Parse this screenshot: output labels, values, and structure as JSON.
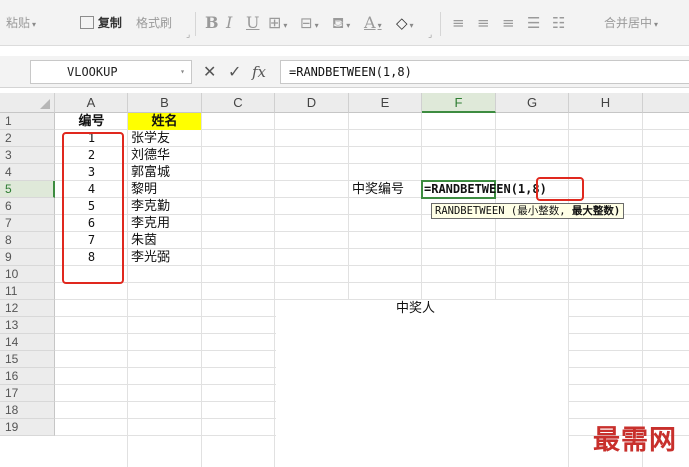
{
  "ribbon": {
    "paste": "粘贴",
    "copy": "复制",
    "format_painter": "格式刷",
    "bold": "B",
    "italic": "I",
    "underline": "U",
    "font_color_letter": "A",
    "merge_center": "合并居中"
  },
  "formula_bar": {
    "name_box": "VLOOKUP",
    "cancel_symbol": "✕",
    "enter_symbol": "✓",
    "fx_label": "fx",
    "formula": "=RANDBETWEEN(1,8)"
  },
  "columns": [
    "A",
    "B",
    "C",
    "D",
    "E",
    "F",
    "G",
    "H"
  ],
  "rows": [
    "1",
    "2",
    "3",
    "4",
    "5",
    "6",
    "7",
    "8",
    "9",
    "10",
    "11",
    "12",
    "13",
    "14",
    "15",
    "16",
    "17",
    "18",
    "19"
  ],
  "sheet": {
    "header_id": "编号",
    "header_name": "姓名",
    "records": [
      {
        "id": "1",
        "name": "张学友"
      },
      {
        "id": "2",
        "name": "刘德华"
      },
      {
        "id": "3",
        "name": "郭富城"
      },
      {
        "id": "4",
        "name": "黎明"
      },
      {
        "id": "5",
        "name": "李克勤"
      },
      {
        "id": "6",
        "name": "李克用"
      },
      {
        "id": "7",
        "name": "朱茵"
      },
      {
        "id": "8",
        "name": "李光弼"
      }
    ],
    "e5_label": "中奖编号",
    "active_cell_func": "=RANDBETWEEN",
    "active_cell_args": "(1,8)",
    "winner_label": "中奖人"
  },
  "tooltip": {
    "func": "RANDBETWEEN",
    "arg1": "(最小整数,",
    "arg2": "最大整数)"
  },
  "watermark": "最需网",
  "colors": {
    "accent_green": "#3d8c40",
    "highlight_yellow": "#ffff00",
    "annotation_red": "#e0281e"
  }
}
